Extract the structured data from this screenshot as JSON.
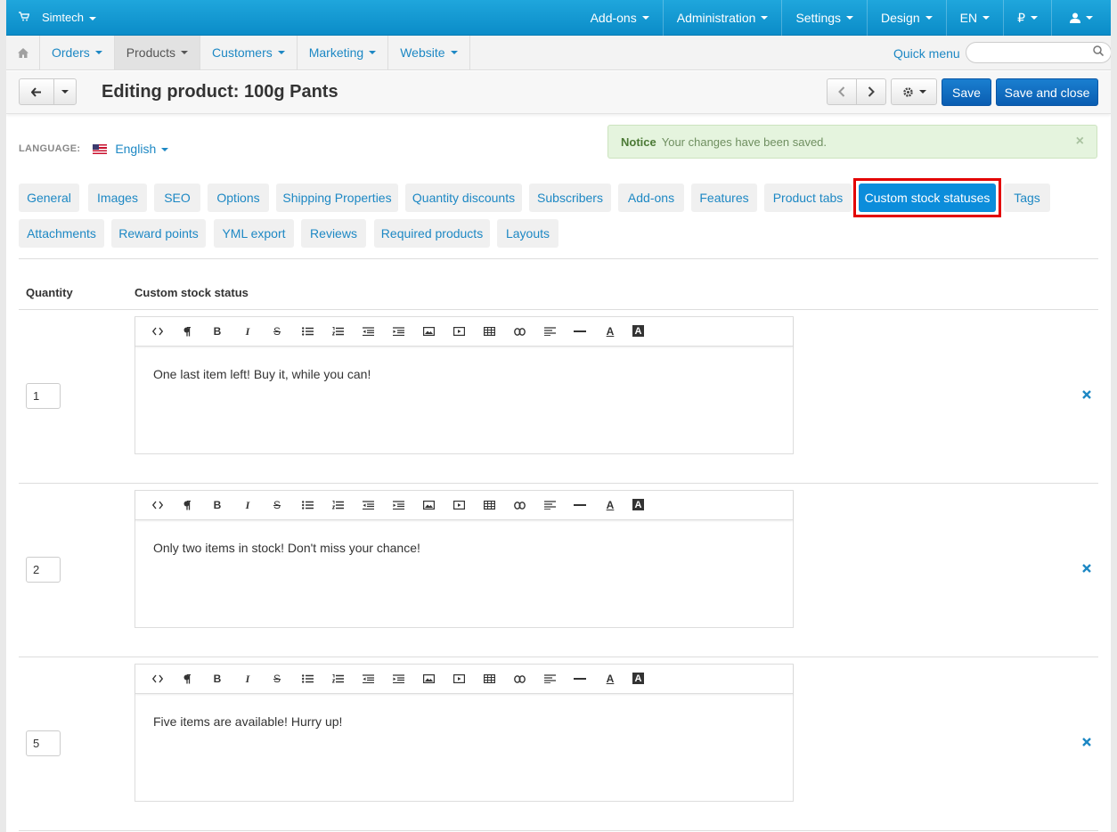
{
  "topbar": {
    "brand": "Simtech",
    "cart_icon": "cart-icon",
    "items": [
      "Add-ons",
      "Administration",
      "Settings",
      "Design",
      "EN",
      "₽",
      "user-icon"
    ]
  },
  "nav": {
    "home_icon": "home-icon",
    "items": [
      "Orders",
      "Products",
      "Customers",
      "Marketing",
      "Website"
    ],
    "active": "Products",
    "quick_menu": "Quick menu",
    "search_placeholder": "",
    "search_icon": "search-icon"
  },
  "titlebar": {
    "title": "Editing product: 100g Pants",
    "save": "Save",
    "save_close": "Save and close"
  },
  "language": {
    "label": "LANGUAGE:",
    "value": "English"
  },
  "notice": {
    "title": "Notice",
    "text": "Your changes have been saved.",
    "close": "×"
  },
  "tabs": {
    "row1": [
      "General",
      "Images",
      "SEO",
      "Options",
      "Shipping Properties",
      "Quantity discounts",
      "Subscribers",
      "Add-ons",
      "Features",
      "Product tabs",
      "Custom stock statuses",
      "Tags"
    ],
    "row2": [
      "Attachments",
      "Reward points",
      "YML export",
      "Reviews",
      "Required products",
      "Layouts"
    ],
    "active": "Custom stock statuses"
  },
  "table": {
    "col_quantity": "Quantity",
    "col_status": "Custom stock status",
    "rows": [
      {
        "quantity": "1",
        "status": "One last item left! Buy it, while you can!"
      },
      {
        "quantity": "2",
        "status": "Only two items in stock! Don't miss your chance!"
      },
      {
        "quantity": "5",
        "status": "Five items are available! Hurry up!"
      }
    ]
  },
  "editor_toolbar": [
    "<>",
    "¶",
    "B",
    "I",
    "S",
    "ul",
    "ol",
    "outdent",
    "indent",
    "image",
    "video",
    "table",
    "link",
    "align",
    "hr",
    "A",
    "A"
  ],
  "colors": {
    "topbar": "#0b8cc8",
    "link": "#1d88c4",
    "active_tab": "#0b8ddb",
    "highlight": "#e30000",
    "notice_bg": "#e5f4de"
  }
}
